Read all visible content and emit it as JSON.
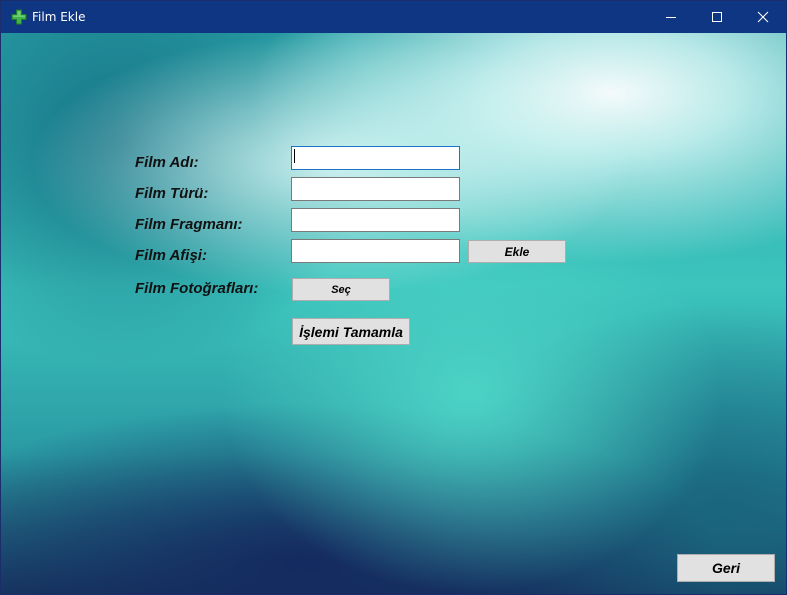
{
  "window": {
    "title": "Film Ekle",
    "icon": "green-plus-icon",
    "controls": [
      "minimize-icon",
      "maximize-icon",
      "close-icon"
    ]
  },
  "form": {
    "film_adi_label": "Film Adı:",
    "film_adi_value": "",
    "film_turu_label": "Film Türü:",
    "film_turu_value": "",
    "film_fragmani_label": "Film Fragmanı:",
    "film_fragmani_value": "",
    "film_afisi_label": "Film Afişi:",
    "film_afisi_value": "",
    "ekle_button": "Ekle",
    "film_fotograflari_label": "Film Fotoğrafları:",
    "sec_button": "Seç",
    "islemi_tamamla_button": "İşlemi Tamamla"
  },
  "footer": {
    "geri_button": "Geri"
  },
  "colors": {
    "titlebar": "#0f3682",
    "button_face": "#e1e1e1",
    "focus_border": "#1a74c8",
    "icon_green": "#3fb54a"
  }
}
